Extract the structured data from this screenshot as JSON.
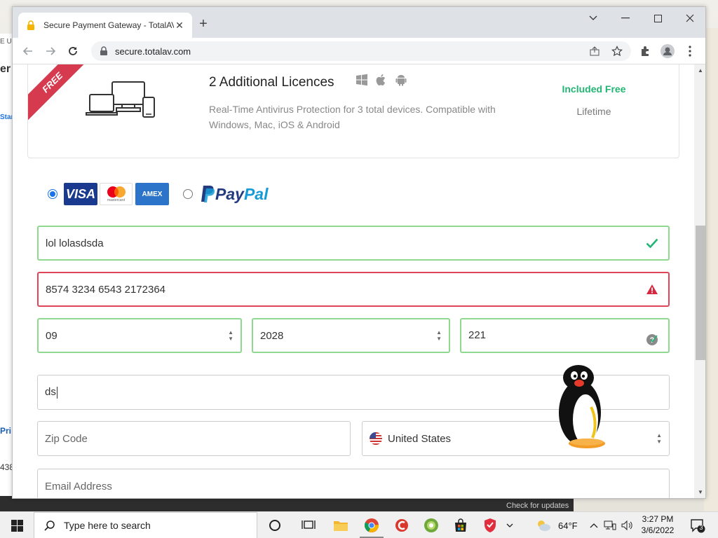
{
  "browser": {
    "tab_title": "Secure Payment Gateway - TotalAV",
    "url": "secure.totalav.com",
    "icons": [
      "lock-icon",
      "close-icon",
      "plus-icon",
      "chevron-down-icon",
      "minimize-icon",
      "maximize-icon",
      "close-icon",
      "back-arrow-icon",
      "forward-arrow-icon",
      "reload-icon",
      "share-icon",
      "star-icon",
      "extension-puzzle-icon",
      "profile-icon",
      "kebab-menu-icon"
    ]
  },
  "product": {
    "ribbon": "FREE",
    "title": "2 Additional Licences",
    "description": "Real-Time Antivirus Protection for 3 total devices. Compatible with Windows, Mac, iOS & Android",
    "price_label": "Included Free",
    "term": "Lifetime",
    "colors": {
      "ribbon": "#d63a4f",
      "included": "#22b573"
    }
  },
  "payment": {
    "selected_method": "card",
    "card_logos": {
      "visa": "VISA",
      "mastercard_sub": "mastercard",
      "amex": "AMEX"
    },
    "paypal_a": "Pay",
    "paypal_b": "Pal"
  },
  "form": {
    "cardholder_name": "lol lolasdsda",
    "card_number": "8574 3234 6543 2172364",
    "exp_month": "09",
    "exp_year": "2028",
    "cvv": "221",
    "address": "ds",
    "zip_placeholder": "Zip Code",
    "country": "United States",
    "email_placeholder": "Email Address",
    "colors": {
      "valid": "#8fd88f",
      "error": "#e0455a"
    }
  },
  "desktop": {
    "bg_text_1": "E U",
    "bg_text_2": "er",
    "bg_text_3": "Star",
    "bg_text_4": "Pri",
    "bg_text_5": "438",
    "check_updates": "Check for updates"
  },
  "taskbar": {
    "search_placeholder": "Type here to search",
    "weather": "64°F",
    "time": "3:27 PM",
    "date": "3/6/2022",
    "notifications": "3"
  }
}
